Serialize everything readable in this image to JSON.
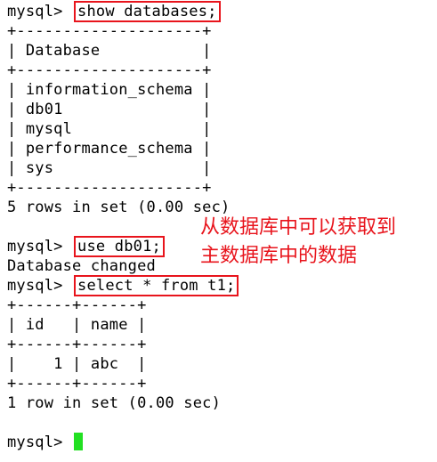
{
  "terminal": {
    "prompt": "mysql> ",
    "lines": {
      "l1_cmd": "show databases;",
      "l2": "+--------------------+",
      "l3": "| Database           |",
      "l4": "+--------------------+",
      "l5": "| information_schema |",
      "l6": "| db01               |",
      "l7": "| mysql              |",
      "l8": "| performance_schema |",
      "l9": "| sys                |",
      "l10": "+--------------------+",
      "l11": "5 rows in set (0.00 sec)",
      "l13_cmd": "use db01;",
      "l14": "Database changed",
      "l15_cmd": "select * from t1;",
      "l16": "+------+------+",
      "l17": "| id   | name |",
      "l18": "+------+------+",
      "l19": "|    1 | abc  |",
      "l20": "+------+------+",
      "l21": "1 row in set (0.00 sec)"
    }
  },
  "annotation": {
    "line1": "从数据库中可以获取到",
    "line2": "主数据库中的数据"
  },
  "colors": {
    "highlight_box": "#e8141c",
    "annotation_text": "#e8141c",
    "cursor": "#22e022"
  }
}
